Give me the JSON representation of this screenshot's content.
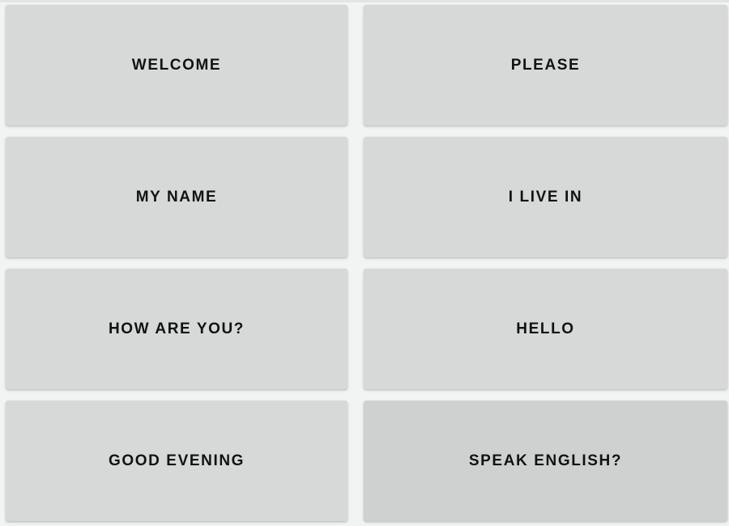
{
  "phrases": {
    "welcome": "WELCOME",
    "please": "PLEASE",
    "my_name": "MY NAME",
    "i_live_in": "I LIVE IN",
    "how_are_you": "HOW ARE YOU?",
    "hello": "HELLO",
    "good_evening": "GOOD EVENING",
    "speak_english": "SPEAK ENGLISH?"
  },
  "colors": {
    "background": "#f2f3f3",
    "button": "#d7d9d8",
    "button_pressed": "#cfd1d0",
    "text": "#121212"
  }
}
